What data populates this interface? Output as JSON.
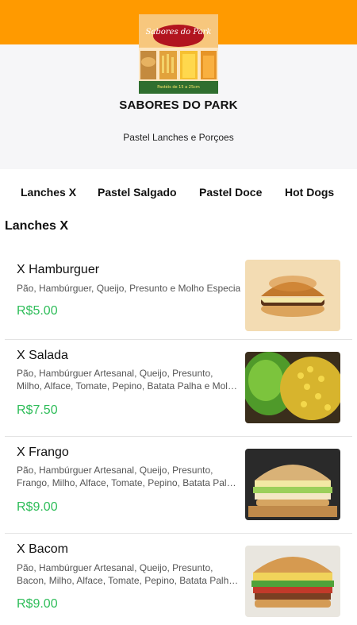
{
  "header": {
    "brand_color": "#ff9a00",
    "store_name": "SABORES DO PARK",
    "store_subtitle": "Pastel Lanches e Porçoes",
    "logo": {
      "title": "Sabores do Park",
      "caption": "Pastéis de 15 a 25cm"
    }
  },
  "tabs": [
    {
      "label": "Lanches X"
    },
    {
      "label": "Pastel Salgado"
    },
    {
      "label": "Pastel Doce"
    },
    {
      "label": "Hot Dogs"
    }
  ],
  "section": {
    "title": "Lanches X"
  },
  "items": [
    {
      "name": "X Hamburguer",
      "description": "Pão, Hambúrguer, Queijo, Presunto e Molho Especial",
      "price": "R$5.00",
      "image": "burger-photo"
    },
    {
      "name": "X Salada",
      "description": "Pão, Hambúrguer Artesanal, Queijo, Presunto, Milho, Alface, Tomate, Pepino, Batata Palha e Molho Especial",
      "price": "R$7.50",
      "image": "salad-photo"
    },
    {
      "name": "X Frango",
      "description": "Pão, Hambúrguer Artesanal, Queijo, Presunto, Frango, Milho, Alface, Tomate, Pepino, Batata Palha e Molho Especial",
      "price": "R$9.00",
      "image": "chicken-sandwich-photo"
    },
    {
      "name": "X Bacom",
      "description": "Pão, Hambúrguer Artesanal, Queijo, Presunto, Bacon, Milho, Alface, Tomate, Pepino, Batata Palha e Molho Especial",
      "price": "R$9.00",
      "image": "bacon-sandwich-photo"
    }
  ],
  "price_color": "#2ebd59"
}
